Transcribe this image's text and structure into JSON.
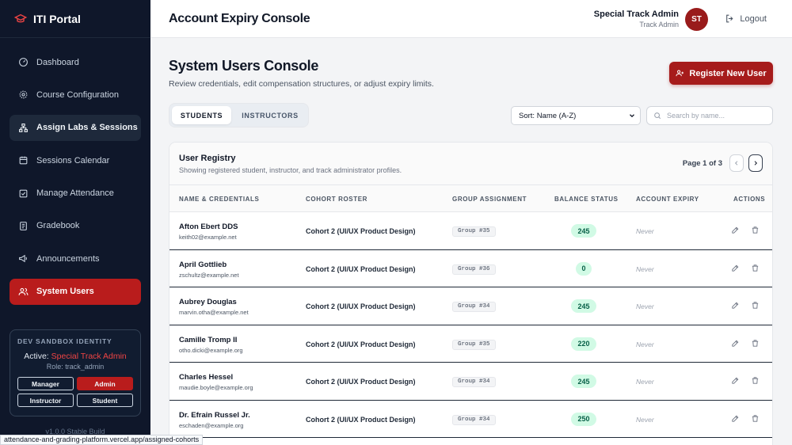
{
  "brand": {
    "name": "ITI Portal"
  },
  "sidebar": {
    "items": [
      {
        "label": "Dashboard",
        "icon": "dashboard-icon",
        "state": "normal"
      },
      {
        "label": "Course Configuration",
        "icon": "gear-icon",
        "state": "normal"
      },
      {
        "label": "Assign Labs & Sessions",
        "icon": "sitemap-icon",
        "state": "highlight"
      },
      {
        "label": "Sessions Calendar",
        "icon": "calendar-icon",
        "state": "normal"
      },
      {
        "label": "Manage Attendance",
        "icon": "checkbox-icon",
        "state": "normal"
      },
      {
        "label": "Gradebook",
        "icon": "document-icon",
        "state": "normal"
      },
      {
        "label": "Announcements",
        "icon": "megaphone-icon",
        "state": "normal"
      },
      {
        "label": "System Users",
        "icon": "users-icon",
        "state": "active"
      }
    ],
    "sandbox": {
      "title": "DEV SANDBOX IDENTITY",
      "active_prefix": "Active: ",
      "active_name": "Special Track Admin",
      "role_text": "Role: track_admin",
      "roles": [
        "Manager",
        "Admin",
        "Instructor",
        "Student"
      ],
      "selected_role": "Admin"
    },
    "version": "v1.0.0 Stable Build"
  },
  "status_url": "attendance-and-grading-platform.vercel.app/assigned-cohorts",
  "header": {
    "title": "Account Expiry Console",
    "user_name": "Special Track Admin",
    "user_role": "Track Admin",
    "avatar_initials": "ST",
    "logout_label": "Logout"
  },
  "main": {
    "title": "System Users Console",
    "subtitle": "Review credentials, edit compensation structures, or adjust expiry limits.",
    "register_label": "Register New User",
    "tabs": [
      {
        "label": "STUDENTS",
        "active": true
      },
      {
        "label": "INSTRUCTORS",
        "active": false
      }
    ],
    "sort_value": "Sort: Name (A-Z)",
    "search_placeholder": "Search by name..."
  },
  "registry": {
    "title": "User Registry",
    "subtitle": "Showing registered student, instructor, and track administrator profiles.",
    "page_text": "Page 1 of 3",
    "columns": [
      "NAME & CREDENTIALS",
      "COHORT ROSTER",
      "GROUP ASSIGNMENT",
      "BALANCE STATUS",
      "ACCOUNT EXPIRY",
      "ACTIONS"
    ],
    "rows": [
      {
        "name": "Afton Ebert DDS",
        "email": "keith02@example.net",
        "cohort": "Cohort 2 (UI/UX Product Design)",
        "group": "Group #35",
        "balance": "245",
        "expiry": "Never"
      },
      {
        "name": "April Gottlieb",
        "email": "zschultz@example.net",
        "cohort": "Cohort 2 (UI/UX Product Design)",
        "group": "Group #36",
        "balance": "0",
        "expiry": "Never"
      },
      {
        "name": "Aubrey Douglas",
        "email": "marvin.otha@example.net",
        "cohort": "Cohort 2 (UI/UX Product Design)",
        "group": "Group #34",
        "balance": "245",
        "expiry": "Never"
      },
      {
        "name": "Camille Tromp II",
        "email": "otho.dicki@example.org",
        "cohort": "Cohort 2 (UI/UX Product Design)",
        "group": "Group #35",
        "balance": "220",
        "expiry": "Never"
      },
      {
        "name": "Charles Hessel",
        "email": "maudie.boyle@example.org",
        "cohort": "Cohort 2 (UI/UX Product Design)",
        "group": "Group #34",
        "balance": "245",
        "expiry": "Never"
      },
      {
        "name": "Dr. Efrain Russel Jr.",
        "email": "eschaden@example.org",
        "cohort": "Cohort 2 (UI/UX Product Design)",
        "group": "Group #34",
        "balance": "250",
        "expiry": "Never"
      }
    ]
  },
  "colors": {
    "accent": "#a61b1b",
    "sidebar_bg": "#0f172a",
    "balance_bg": "#d1fae5",
    "balance_text": "#065f46"
  }
}
